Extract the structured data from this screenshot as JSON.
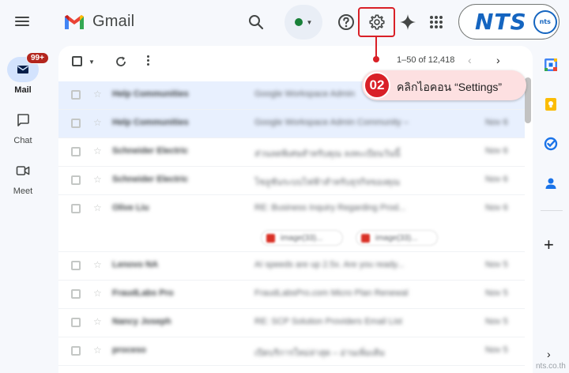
{
  "header": {
    "app_name": "Gmail",
    "brand_logo_text": "NTS",
    "brand_badge_text": "nts"
  },
  "rail": {
    "items": [
      {
        "label": "Mail",
        "badge": "99+"
      },
      {
        "label": "Chat"
      },
      {
        "label": "Meet"
      }
    ]
  },
  "toolbar": {
    "pagination": "1–50 of 12,418"
  },
  "mail_rows": [
    {
      "sender": "Help Communities",
      "subject": "Google Workspace Admin",
      "date": "Nov 6"
    },
    {
      "sender": "Help Communities",
      "subject": "Google Workspace Admin Community –",
      "date": "Nov 6"
    },
    {
      "sender": "Schneider Electric",
      "subject": "ส่วนลดพิเศษสำหรับคุณ ลงทะเบียนวันนี้",
      "date": "Nov 6"
    },
    {
      "sender": "Schneider Electric",
      "subject": "โซลูชันระบบไฟฟ้าสำหรับธุรกิจของคุณ",
      "date": "Nov 6"
    },
    {
      "sender": "Olive Liu",
      "subject": "RE: Business Inquiry Regarding Prod...",
      "date": "Nov 6",
      "attachments": [
        "image(33)...",
        "image(33)..."
      ]
    },
    {
      "sender": "Lenovo NA",
      "subject": "AI speeds are up 2.5x. Are you ready...",
      "date": "Nov 5"
    },
    {
      "sender": "FraudLabs Pro",
      "subject": "FraudLabsPro.com Micro Plan Renewal",
      "date": "Nov 5"
    },
    {
      "sender": "Nancy Joseph",
      "subject": "RE: SCP Solution Providers Email List",
      "date": "Nov 5"
    },
    {
      "sender": "proceso",
      "subject": "เปิดบริการใหม่ล่าสุด – อ่านเพิ่มเติม",
      "date": "Nov 5"
    }
  ],
  "annotation": {
    "step_number": "02",
    "text": "คลิกไอคอน “Settings”"
  },
  "watermark": "nts.co.th",
  "colors": {
    "accent_red": "#d92027",
    "callout_bg": "#fde0e1",
    "selected_row": "#e8f0fe",
    "brand_blue": "#1565c0"
  }
}
